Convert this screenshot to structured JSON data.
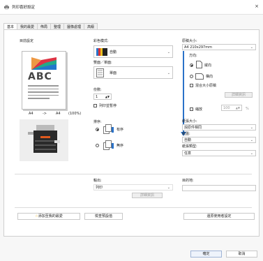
{
  "window": {
    "title": "列印喜好設定",
    "close": "×"
  },
  "tabs": [
    "基本",
    "我的最愛",
    "佈局",
    "整理",
    "圖像處理",
    "高級"
  ],
  "left": {
    "original_settings": "目前設定",
    "preview_text": "ABC",
    "paper_from": "A4",
    "arrow": "->",
    "paper_to": "A4",
    "zoom": "(100%)"
  },
  "color": {
    "label": "彩色模式:",
    "value": "自動"
  },
  "duplex": {
    "label": "雙面／單面:",
    "value": "單面"
  },
  "copies": {
    "label": "份數:",
    "value": "1"
  },
  "pause": {
    "label": "列印並暫停"
  },
  "sort": {
    "label": "排序:",
    "option1": "有序",
    "option2": "無序"
  },
  "original_size": {
    "label": "原稿大小:",
    "value": "A4 210x297mm"
  },
  "orientation": {
    "label": "方向:",
    "portrait": "縱向",
    "landscape": "橫向",
    "mixed": "混合大小原稿",
    "detail": "詳細資訊"
  },
  "scale": {
    "label": "縮放",
    "value": "100",
    "unit": "%"
  },
  "paper_size": {
    "label": "紙張大小:",
    "value": "與原件相同"
  },
  "tray": {
    "label": "紙盤:",
    "value": "自動"
  },
  "paper_type": {
    "label": "紙張類型:",
    "value": "任意"
  },
  "output": {
    "label": "輸出:",
    "value": "列印",
    "detail": "詳細資訊"
  },
  "destination": {
    "label": "目的地:",
    "value": ""
  },
  "footer": {
    "add_favorite": "添加至我的最愛",
    "check_settings": "檢查預設值",
    "restore": "還原使用者設定",
    "ok": "確定",
    "cancel": "取消"
  },
  "colors": {
    "accent": "#2a72c8",
    "printer_orange": "#e05a1e"
  }
}
